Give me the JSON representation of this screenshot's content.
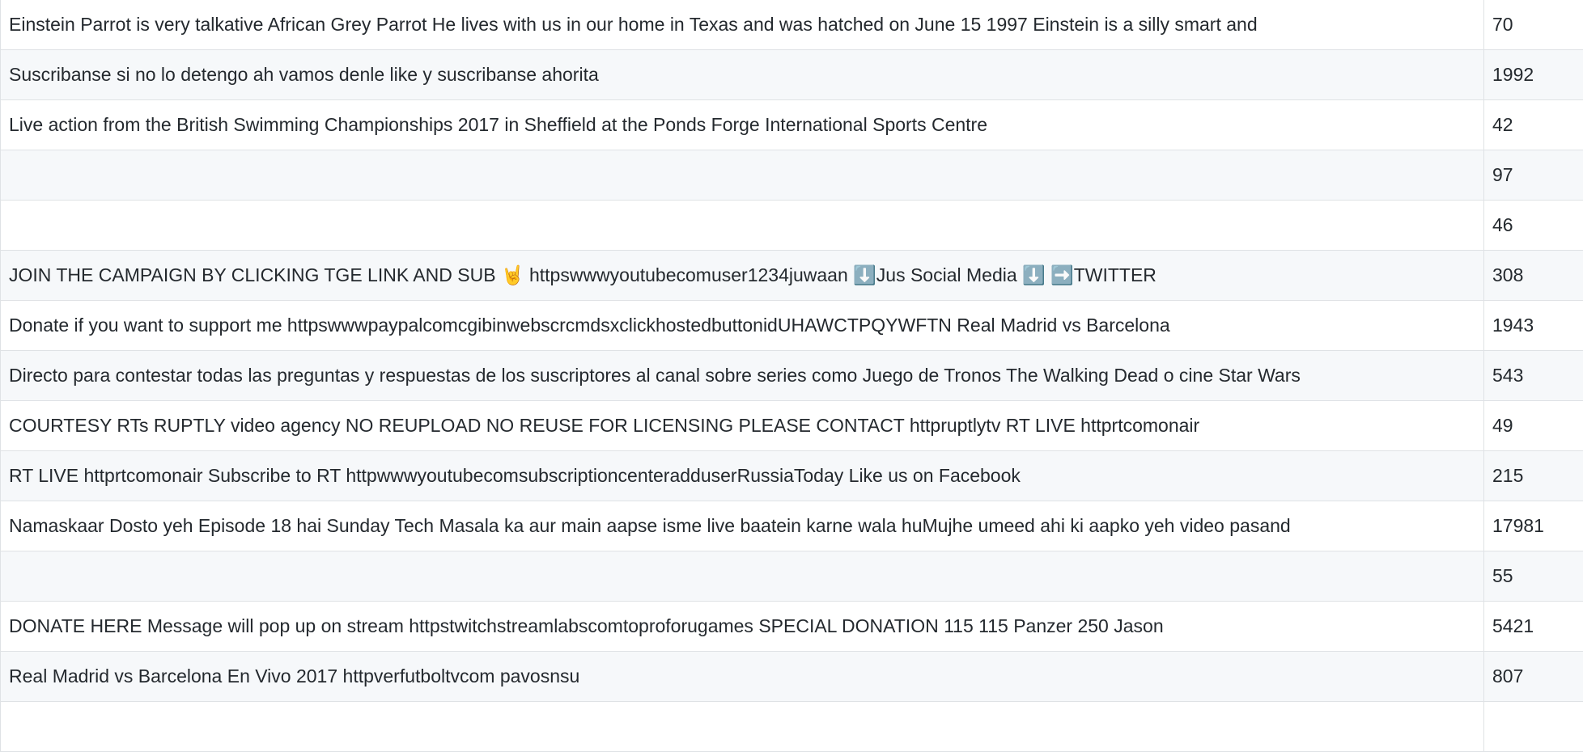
{
  "table": {
    "rows": [
      {
        "text": "Einstein Parrot is very talkative African Grey Parrot He lives with us in our home in Texas and was hatched on June 15 1997 Einstein is a silly smart and",
        "value": "70"
      },
      {
        "text": "Suscribanse si no lo detengo ah vamos denle like y suscribanse ahorita",
        "value": "1992"
      },
      {
        "text": "Live action from the British Swimming Championships 2017 in Sheffield at the Ponds Forge International Sports Centre",
        "value": "42"
      },
      {
        "text": "",
        "value": "97"
      },
      {
        "text": "",
        "value": "46"
      },
      {
        "text": "JOIN THE CAMPAIGN BY CLICKING TGE LINK AND SUB 🤘 httpswwwyoutubecomuser1234juwaan ⬇️Jus Social Media ⬇️ ➡️TWITTER",
        "value": "308"
      },
      {
        "text": "Donate if you want to support me httpswwwpaypalcomcgibinwebscrcmdsxclickhostedbuttonidUHAWCTPQYWFTN Real Madrid vs Barcelona",
        "value": "1943"
      },
      {
        "text": "Directo para contestar todas las preguntas y respuestas de los suscriptores al canal sobre series como Juego de Tronos The Walking Dead o cine Star Wars",
        "value": "543"
      },
      {
        "text": "COURTESY RTs RUPTLY video agency NO REUPLOAD NO REUSE FOR LICENSING PLEASE CONTACT httpruptlytv RT LIVE httprtcomonair",
        "value": "49"
      },
      {
        "text": "RT LIVE httprtcomonair Subscribe to RT httpwwwyoutubecomsubscriptioncenteradduserRussiaToday Like us on Facebook",
        "value": "215"
      },
      {
        "text": "Namaskaar Dosto yeh Episode 18 hai Sunday Tech Masala ka aur main aapse isme live baatein karne wala huMujhe umeed ahi ki aapko yeh video pasand",
        "value": "17981"
      },
      {
        "text": "",
        "value": "55"
      },
      {
        "text": "DONATE HERE Message will pop up on stream httpstwitchstreamlabscomtoproforugames SPECIAL DONATION 115 115 Panzer 250 Jason",
        "value": "5421"
      },
      {
        "text": "Real Madrid vs Barcelona En Vivo 2017 httpverfutboltvcom pavosnsu",
        "value": "807"
      },
      {
        "text": "",
        "value": ""
      }
    ]
  }
}
